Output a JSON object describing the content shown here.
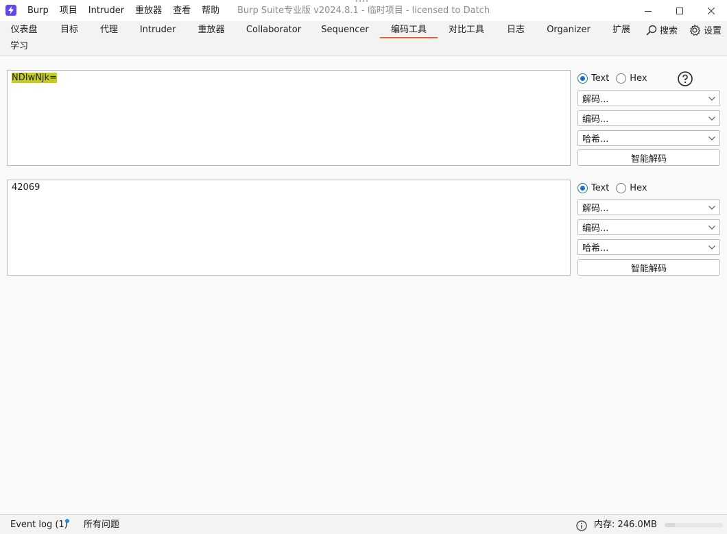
{
  "titlebar": {
    "window_title": "Burp Suite专业版  v2024.8.1 - 临时项目 - licensed to Datch",
    "menu": [
      "Burp",
      "项目",
      "Intruder",
      "重放器",
      "查看",
      "帮助"
    ]
  },
  "tabs": [
    {
      "label": "仪表盘"
    },
    {
      "label": "目标"
    },
    {
      "label": "代理"
    },
    {
      "label": "Intruder"
    },
    {
      "label": "重放器"
    },
    {
      "label": "Collaborator"
    },
    {
      "label": "Sequencer"
    },
    {
      "label": "编码工具",
      "active": true
    },
    {
      "label": "对比工具"
    },
    {
      "label": "日志"
    },
    {
      "label": "Organizer"
    },
    {
      "label": "扩展"
    },
    {
      "label": "学习"
    }
  ],
  "tools": {
    "search_label": "搜索",
    "settings_label": "设置"
  },
  "panels": [
    {
      "content": "NDIwNjk=",
      "highlighted": true,
      "mode_text": "Text",
      "mode_hex": "Hex",
      "selected_mode": "Text",
      "decode_label": "解码...",
      "encode_label": "编码...",
      "hash_label": "哈希...",
      "smart_decode_label": "智能解码"
    },
    {
      "content": "42069",
      "highlighted": false,
      "mode_text": "Text",
      "mode_hex": "Hex",
      "selected_mode": "Text",
      "decode_label": "解码...",
      "encode_label": "编码...",
      "hash_label": "哈希...",
      "smart_decode_label": "智能解码"
    }
  ],
  "statusbar": {
    "event_log": "Event log (1)",
    "all_issues": "所有问题",
    "memory": "内存: 246.0MB"
  },
  "colors": {
    "accent_tab": "#e8622c",
    "highlight": "#c8cc1c",
    "radio_selected": "#1c6fc0",
    "logo": "#5b4cf0",
    "notification_dot": "#1a8fe0"
  }
}
